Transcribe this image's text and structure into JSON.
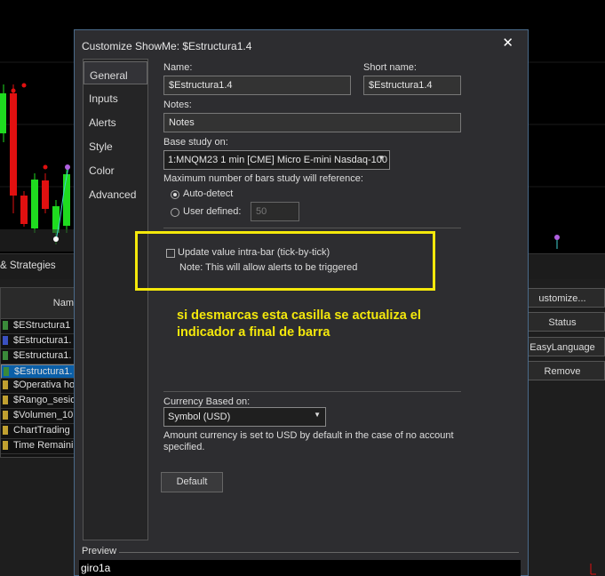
{
  "background": {
    "analysis_tab_label": "& Strategies",
    "list_header": "Nam",
    "list_rows": [
      {
        "label": "$EStructura1",
        "marker": "#3a8a3a",
        "selected": false
      },
      {
        "label": "$Estructura1.",
        "marker": "#3a50c0",
        "selected": false
      },
      {
        "label": "$Estructura1.",
        "marker": "#3a8a3a",
        "selected": false
      },
      {
        "label": "$Estructura1.",
        "marker": "#3a8a3a",
        "selected": true
      },
      {
        "label": "$Operativa ho",
        "marker": "#c0a030",
        "selected": false
      },
      {
        "label": "$Rango_sesio",
        "marker": "#c0a030",
        "selected": false
      },
      {
        "label": "$Volumen_10",
        "marker": "#c0a030",
        "selected": false
      },
      {
        "label": "ChartTrading",
        "marker": "#c0a030",
        "selected": false
      },
      {
        "label": "Time Remainin",
        "marker": "#c0a030",
        "selected": false
      }
    ],
    "right_buttons": [
      "ustomize...",
      "Status",
      "EasyLanguage",
      "Remove"
    ]
  },
  "dialog": {
    "title": "Customize ShowMe: $Estructura1.4",
    "close_glyph": "✕",
    "nav": [
      "General",
      "Inputs",
      "Alerts",
      "Style",
      "Color",
      "Advanced"
    ],
    "active_nav": "General",
    "name_label": "Name:",
    "name_value": "$Estructura1.4",
    "short_name_label": "Short name:",
    "short_name_value": "$Estructura1.4",
    "notes_label": "Notes:",
    "notes_value": "Notes",
    "base_study_label": "Base study on:",
    "base_study_value": "1:MNQM23 1 min [CME] Micro E-mini Nasdaq-100",
    "max_bars_label": "Maximum number of bars study will reference:",
    "auto_detect_label": "Auto-detect",
    "auto_detect_selected": true,
    "user_defined_label": "User defined:",
    "user_defined_value": "50",
    "update_intrabar_label": "Update value intra-bar (tick-by-tick)",
    "update_intrabar_checked": false,
    "update_intrabar_note": "Note: This will allow alerts to be triggered",
    "currency_label": "Currency Based on:",
    "currency_value": "Symbol (USD)",
    "currency_note": "Amount currency is set to USD by default in the case of no account specified.",
    "default_button": "Default",
    "preview_label": "Preview",
    "preview_text": "giro1a"
  },
  "annotation": {
    "text": "si desmarcas esta casilla se actualiza el indicador a final de barra",
    "color": "#f4e80b"
  }
}
